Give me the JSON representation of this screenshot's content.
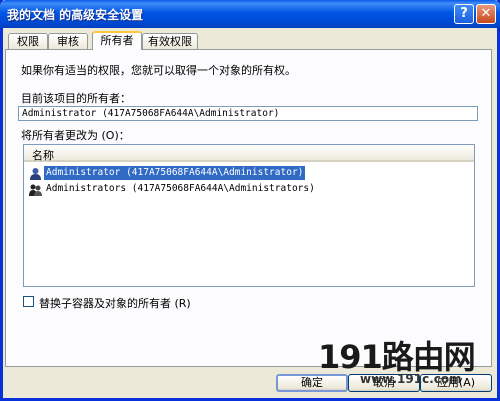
{
  "window": {
    "title": "我的文档 的高级安全设置"
  },
  "title_buttons": {
    "help": "?",
    "close": "✕"
  },
  "tabs": [
    {
      "label": "权限"
    },
    {
      "label": "审核"
    },
    {
      "label": "所有者"
    },
    {
      "label": "有效权限"
    }
  ],
  "active_tab": "所有者",
  "panel": {
    "intro": "如果你有适当的权限，您就可以取得一个对象的所有权。",
    "current_owner_label": "目前该项目的所有者：",
    "current_owner_value": "Administrator (417A75068FA644A\\Administrator)",
    "change_owner_label": "将所有者更改为 (O)：",
    "list_header": "名称",
    "owners": [
      {
        "name": "Administrator (417A75068FA644A\\Administrator)",
        "selected": true,
        "icon": "user-icon"
      },
      {
        "name": "Administrators (417A75068FA644A\\Administrators)",
        "selected": false,
        "icon": "user-group-icon"
      }
    ],
    "replace_checkbox_label": "替换子容器及对象的所有者 (R)",
    "replace_checked": false
  },
  "buttons": {
    "ok": "确定",
    "cancel": "取消",
    "apply": "应用(A)"
  },
  "watermark": {
    "text": "191路由网",
    "url": "www.191c.com"
  },
  "colors": {
    "title_bar": "#0055e5",
    "selection": "#316ac5",
    "dialog_bg": "#ece9d8"
  }
}
